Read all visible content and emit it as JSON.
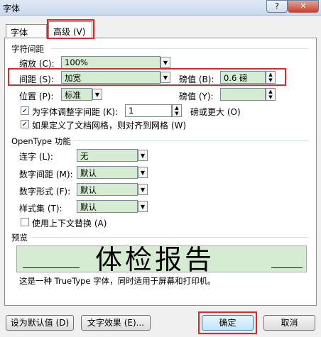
{
  "window": {
    "title": "字体",
    "help_label": "?",
    "close_label": "✕"
  },
  "tabs": [
    {
      "label": "字体 (N)"
    },
    {
      "label": "高级 (V)"
    }
  ],
  "char_spacing": {
    "heading": "字符间距",
    "scale_label": "缩放 (C):",
    "scale_value": "100%",
    "spacing_label": "间距 (S):",
    "spacing_value": "加宽",
    "spacing_by_label": "磅值 (B):",
    "spacing_by_value": "0.6 磅",
    "position_label": "位置 (P):",
    "position_value": "标准",
    "position_by_label": "磅值 (Y):",
    "position_by_value": "",
    "kerning_label": "为字体调整字间距 (K):",
    "kerning_value": "1",
    "kerning_suffix": "磅或更大 (O)",
    "grid_label": "如果定义了文档网格，则对齐到网格 (W)"
  },
  "opentype": {
    "heading": "OpenType 功能",
    "ligatures_label": "连字 (L):",
    "ligatures_value": "无",
    "num_spacing_label": "数字间距 (M):",
    "num_spacing_value": "默认",
    "num_forms_label": "数字形式 (F):",
    "num_forms_value": "默认",
    "stylistic_label": "样式集 (T):",
    "stylistic_value": "默认",
    "contextual_label": "使用上下文替换 (A)"
  },
  "preview": {
    "heading": "预览",
    "sample": "体检报告",
    "description": "这是一种 TrueType 字体，同时适用于屏幕和打印机。"
  },
  "footer": {
    "set_default_label": "设为默认值 (D)",
    "text_effects_label": "文字效果 (E)...",
    "ok_label": "确定",
    "cancel_label": "取消"
  }
}
